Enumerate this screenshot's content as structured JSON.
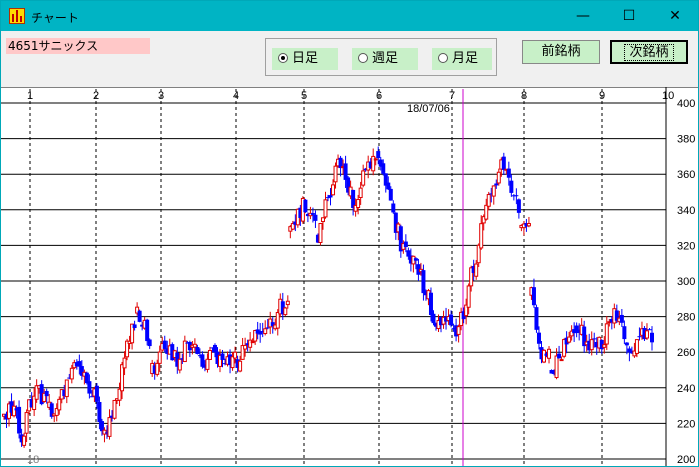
{
  "window": {
    "title": "チャート",
    "minimize_glyph": "—",
    "maximize_glyph": "☐",
    "close_glyph": "✕"
  },
  "toolbar": {
    "stock_label": "4651サニックス",
    "period_options": [
      {
        "label": "日足",
        "selected": true
      },
      {
        "label": "週足",
        "selected": false
      },
      {
        "label": "月足",
        "selected": false
      }
    ],
    "prev_button": "前銘柄",
    "next_button": "次銘柄"
  },
  "chart_data": {
    "type": "candlestick",
    "date_marker": "18/07/06",
    "year_label": "18",
    "month_labels": [
      "1",
      "2",
      "3",
      "4",
      "5",
      "6",
      "7",
      "8",
      "9",
      "10"
    ],
    "y_ticks": [
      200,
      220,
      240,
      260,
      280,
      300,
      320,
      340,
      360,
      380,
      400
    ],
    "ylim": [
      200,
      400
    ],
    "grid": true,
    "colors": {
      "up": "#e00000",
      "down": "#0000ff",
      "marker": "#cc00cc",
      "grid": "#000000"
    },
    "segments": [
      {
        "n": 18,
        "start": 224,
        "pts": [
          226,
          214,
          234,
          238,
          229
        ]
      },
      {
        "n": 12,
        "start": 229,
        "pts": [
          230,
          248,
          255
        ]
      },
      {
        "n": 10,
        "start": 255,
        "pts": [
          244,
          233,
          210
        ]
      },
      {
        "n": 13,
        "start": 214,
        "pts": [
          231,
          260,
          282
        ]
      },
      {
        "n": 6,
        "start": 282,
        "pts": [
          272,
          252
        ]
      },
      {
        "n": 34,
        "start": 248,
        "pts": [
          262,
          255,
          266,
          253,
          262,
          252,
          256
        ]
      },
      {
        "n": 21,
        "start": 256,
        "pts": [
          268,
          277,
          282,
          290
        ]
      },
      {
        "n": 11,
        "start": 328,
        "pts": [
          345,
          326
        ]
      },
      {
        "n": 24,
        "start": 326,
        "pts": [
          348,
          372,
          339,
          365,
          373
        ]
      },
      {
        "n": 20,
        "start": 373,
        "pts": [
          340,
          318,
          310,
          290
        ]
      },
      {
        "n": 12,
        "start": 290,
        "pts": [
          272,
          276,
          270
        ]
      },
      {
        "n": 25,
        "start": 270,
        "pts": [
          310,
          352,
          368,
          330
        ]
      },
      {
        "n": 4,
        "start": 330,
        "pts": [
          340
        ]
      },
      {
        "n": 8,
        "start": 292,
        "pts": [
          262,
          255
        ]
      },
      {
        "n": 10,
        "start": 250,
        "pts": [
          262,
          275
        ]
      },
      {
        "n": 31,
        "start": 275,
        "pts": [
          262,
          264,
          286,
          262,
          268,
          272
        ]
      }
    ]
  }
}
